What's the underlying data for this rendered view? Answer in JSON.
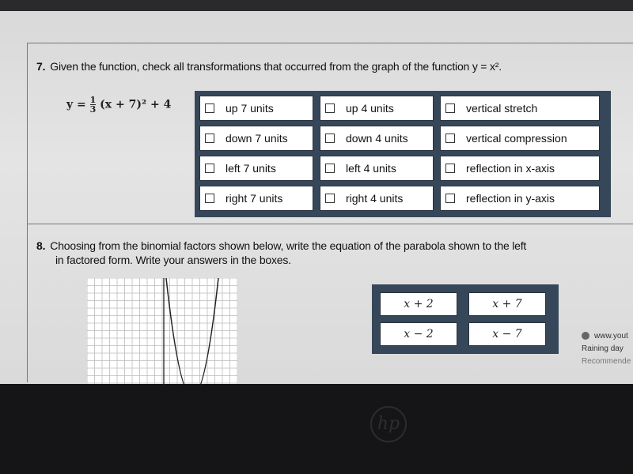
{
  "q7": {
    "number": "7.",
    "prompt": "Given the function, check all transformations that occurred from the graph of the function y = x².",
    "function": {
      "prefix": "y =",
      "numerator": "1",
      "denominator": "3",
      "suffix": "(x + 7)² + 4"
    },
    "options": [
      [
        "up 7 units",
        "up 4 units",
        "vertical stretch"
      ],
      [
        "down 7 units",
        "down 4 units",
        "vertical compression"
      ],
      [
        "left 7 units",
        "left 4 units",
        "reflection in x-axis"
      ],
      [
        "right 7 units",
        "right 4 units",
        "reflection in y-axis"
      ]
    ]
  },
  "q8": {
    "number": "8.",
    "prompt_line1": "Choosing from the binomial factors shown below, write the equation of the parabola shown to the left",
    "prompt_line2": "in factored form.  Write your answers in the boxes.",
    "factors": [
      "x + 2",
      "x + 7",
      "x − 2",
      "x − 7"
    ]
  },
  "youtube_popup": {
    "url": "www.yout",
    "title": "Raining day",
    "subtitle": "Recommende"
  },
  "brand": "hp"
}
